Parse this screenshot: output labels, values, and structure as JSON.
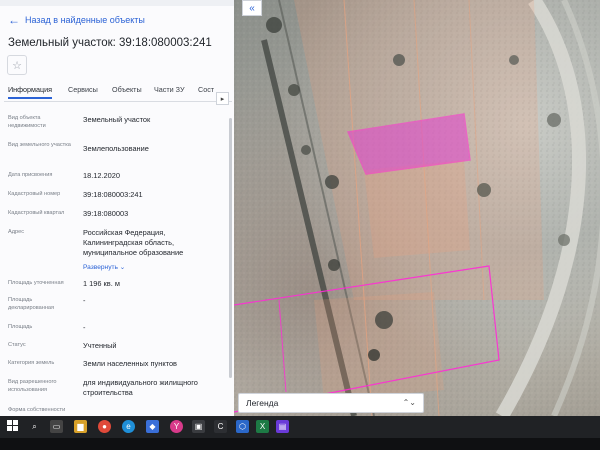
{
  "panel": {
    "back_label": "Назад в найденные объекты",
    "title": "Земельный участок: 39:18:080003:241",
    "tabs": [
      {
        "label": "Информация",
        "active": true
      },
      {
        "label": "Сервисы"
      },
      {
        "label": "Объекты"
      },
      {
        "label": "Части ЗУ"
      },
      {
        "label": "Сост"
      }
    ],
    "rows": [
      {
        "label": "Вид объекта недвижимости",
        "value": "Земельный участок"
      },
      {
        "label": "Вид земельного участка",
        "value": "Землепользование"
      },
      {
        "label": "Дата присвоения",
        "value": "18.12.2020"
      },
      {
        "label": "Кадастровый номер",
        "value": "39:18:080003:241"
      },
      {
        "label": "Кадастровый квартал",
        "value": "39:18:080003"
      },
      {
        "label": "Адрес",
        "value": "Российская Федерация, Калининградская область, муниципальное образование"
      },
      {
        "label": "Площадь уточненная",
        "value": "1 196 кв. м"
      },
      {
        "label": "Площадь декларированная",
        "value": "-"
      },
      {
        "label": "Площадь",
        "value": "-"
      },
      {
        "label": "Статус",
        "value": "Учтенный"
      },
      {
        "label": "Категория земель",
        "value": "Земли населенных пунктов"
      },
      {
        "label": "Вид разрешенного использования",
        "value": "для индивидуального жилищного строительства"
      },
      {
        "label": "Форма собственности",
        "value": ""
      }
    ],
    "expand_label": "Развернуть"
  },
  "map": {
    "legend_label": "Легенда",
    "collapse_icon": "chevron-left-icon"
  },
  "colors": {
    "accent": "#2c63d6",
    "parcel_selected": "#e43fd0",
    "parcel_outline": "#ff2bd6",
    "parcel_fill_other": "#f0a07a"
  }
}
